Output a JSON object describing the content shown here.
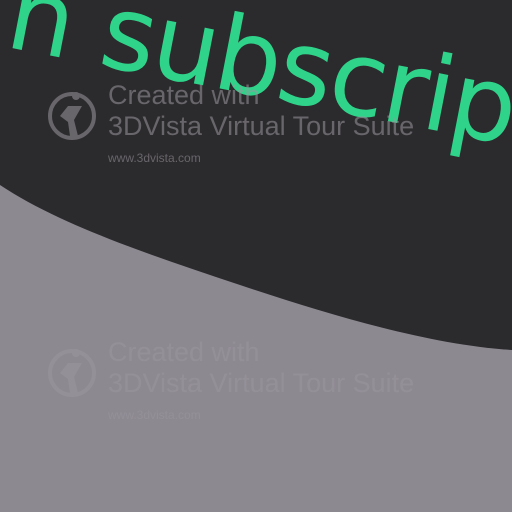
{
  "banner": {
    "text": "n subscription",
    "color": "#2fd38a"
  },
  "colors": {
    "dark_panel": "#2b2a2c",
    "light_panel": "#8d8991",
    "watermark": "#9b969f"
  },
  "watermarks": [
    {
      "line1": "Created with",
      "line2": "3DVista Virtual Tour Suite",
      "url": "www.3dvista.com",
      "icon": "3dvista-logo-icon"
    },
    {
      "line1": "Created with",
      "line2": "3DVista Virtual Tour Suite",
      "url": "www.3dvista.com",
      "icon": "3dvista-logo-icon"
    }
  ]
}
